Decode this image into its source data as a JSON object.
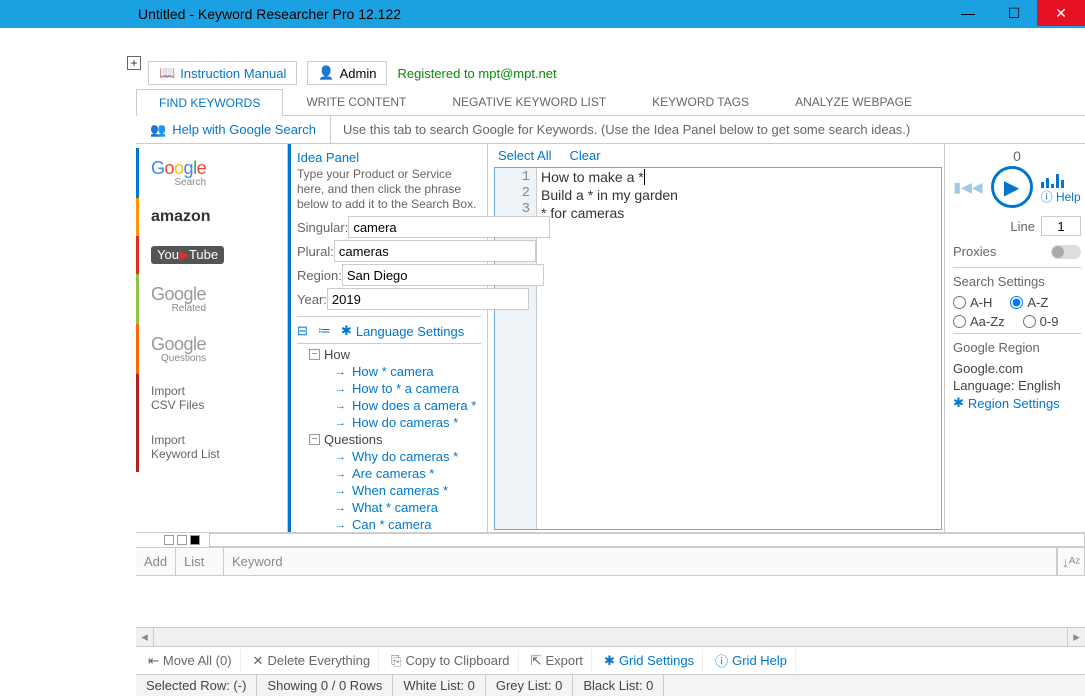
{
  "window": {
    "title": "Untitled - Keyword Researcher Pro 12.122"
  },
  "topbar": {
    "manual": "Instruction Manual",
    "admin": "Admin",
    "registered": "Registered to mpt@mpt.net"
  },
  "tabs": [
    "FIND KEYWORDS",
    "WRITE CONTENT",
    "NEGATIVE KEYWORD LIST",
    "KEYWORD TAGS",
    "ANALYZE WEBPAGE"
  ],
  "helprow": {
    "link": "Help with Google Search",
    "desc": "Use this tab to search Google for Keywords. (Use the Idea Panel below to get some search ideas.)"
  },
  "sources": {
    "google_sub": "Search",
    "amazon": "amazon",
    "youtube_pre": "You",
    "youtube_post": "Tube",
    "grel_sub": "Related",
    "gq_sub": "Questions",
    "import_csv_l1": "Import",
    "import_csv_l2": "CSV Files",
    "import_kw_l1": "Import",
    "import_kw_l2": "Keyword List"
  },
  "ideapanel": {
    "title": "Idea Panel",
    "desc": "Type your Product or Service here, and then click the phrase below to add it to the Search Box.",
    "singular_lab": "Singular:",
    "singular_val": "camera",
    "plural_lab": "Plural:",
    "plural_val": "cameras",
    "region_lab": "Region:",
    "region_val": "San Diego",
    "year_lab": "Year:",
    "year_val": "2019",
    "lang": "Language Settings",
    "tree": {
      "how": "How",
      "how_items": [
        "How * camera",
        "How to * a camera",
        "How does a camera *",
        "How do cameras *"
      ],
      "questions": "Questions",
      "q_items": [
        "Why do cameras *",
        "Are cameras *",
        "When cameras *",
        "What * camera",
        "Can * camera"
      ]
    }
  },
  "editor": {
    "select_all": "Select All",
    "clear": "Clear",
    "lines": [
      "How to make a *",
      "Build a * in my garden",
      "* for cameras"
    ]
  },
  "right": {
    "count": "0",
    "help": "Help",
    "line_lab": "Line",
    "line_val": "1",
    "proxies": "Proxies",
    "ss_title": "Search Settings",
    "opts": {
      "ah": "A-H",
      "az": "A-Z",
      "aazz": "Aa-Zz",
      "d09": "0-9"
    },
    "gr_title": "Google Region",
    "domain": "Google.com",
    "lang": "Language: English",
    "region_link": "Region Settings"
  },
  "grid": {
    "add": "Add",
    "list": "List",
    "keyword": "Keyword"
  },
  "bottom": {
    "moveall": "Move All (0)",
    "delete": "Delete Everything",
    "copy": "Copy to Clipboard",
    "export": "Export",
    "gridset": "Grid Settings",
    "gridhelp": "Grid Help"
  },
  "status": {
    "selrow": "Selected Row: (-)",
    "showing": "Showing 0 / 0 Rows",
    "white": "White List: 0",
    "grey": "Grey List: 0",
    "black": "Black List: 0"
  }
}
